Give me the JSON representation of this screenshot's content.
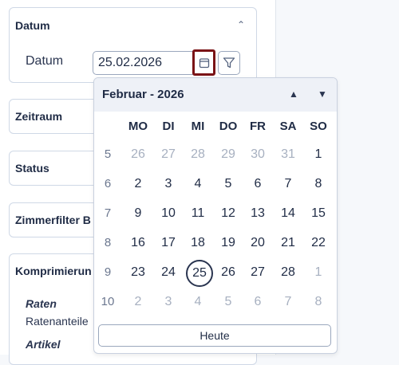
{
  "panels": {
    "datum": {
      "title": "Datum",
      "field_label": "Datum",
      "value": "25.02.2026"
    },
    "zeitraum": {
      "title": "Zeitraum"
    },
    "status": {
      "title": "Status"
    },
    "zimmerfilter": {
      "title": "Zimmerfilter B"
    },
    "komprimierung": {
      "title": "Komprimierun",
      "raten_label": "Raten",
      "raten_value": "Ratenanteile",
      "artikel_label": "Artikel"
    }
  },
  "calendar": {
    "title": "Februar - 2026",
    "weekdays": [
      "MO",
      "DI",
      "MI",
      "DO",
      "FR",
      "SA",
      "SO"
    ],
    "weeks": [
      "5",
      "6",
      "7",
      "8",
      "9",
      "10"
    ],
    "days": [
      [
        "26",
        "27",
        "28",
        "29",
        "30",
        "31",
        "1"
      ],
      [
        "2",
        "3",
        "4",
        "5",
        "6",
        "7",
        "8"
      ],
      [
        "9",
        "10",
        "11",
        "12",
        "13",
        "14",
        "15"
      ],
      [
        "16",
        "17",
        "18",
        "19",
        "20",
        "21",
        "22"
      ],
      [
        "23",
        "24",
        "25",
        "26",
        "27",
        "28",
        "1"
      ],
      [
        "2",
        "3",
        "4",
        "5",
        "6",
        "7",
        "8"
      ]
    ],
    "muted": [
      [
        true,
        true,
        true,
        true,
        true,
        true,
        false
      ],
      [
        false,
        false,
        false,
        false,
        false,
        false,
        false
      ],
      [
        false,
        false,
        false,
        false,
        false,
        false,
        false
      ],
      [
        false,
        false,
        false,
        false,
        false,
        false,
        false
      ],
      [
        false,
        false,
        false,
        false,
        false,
        false,
        true
      ],
      [
        true,
        true,
        true,
        true,
        true,
        true,
        true
      ]
    ],
    "selected_day": "25",
    "today_label": "Heute"
  },
  "icons": {
    "calendar": "calendar-icon",
    "filter": "filter-icon",
    "collapse": "chevron-up-icon",
    "prev": "triangle-up-icon",
    "next": "triangle-down-icon"
  }
}
